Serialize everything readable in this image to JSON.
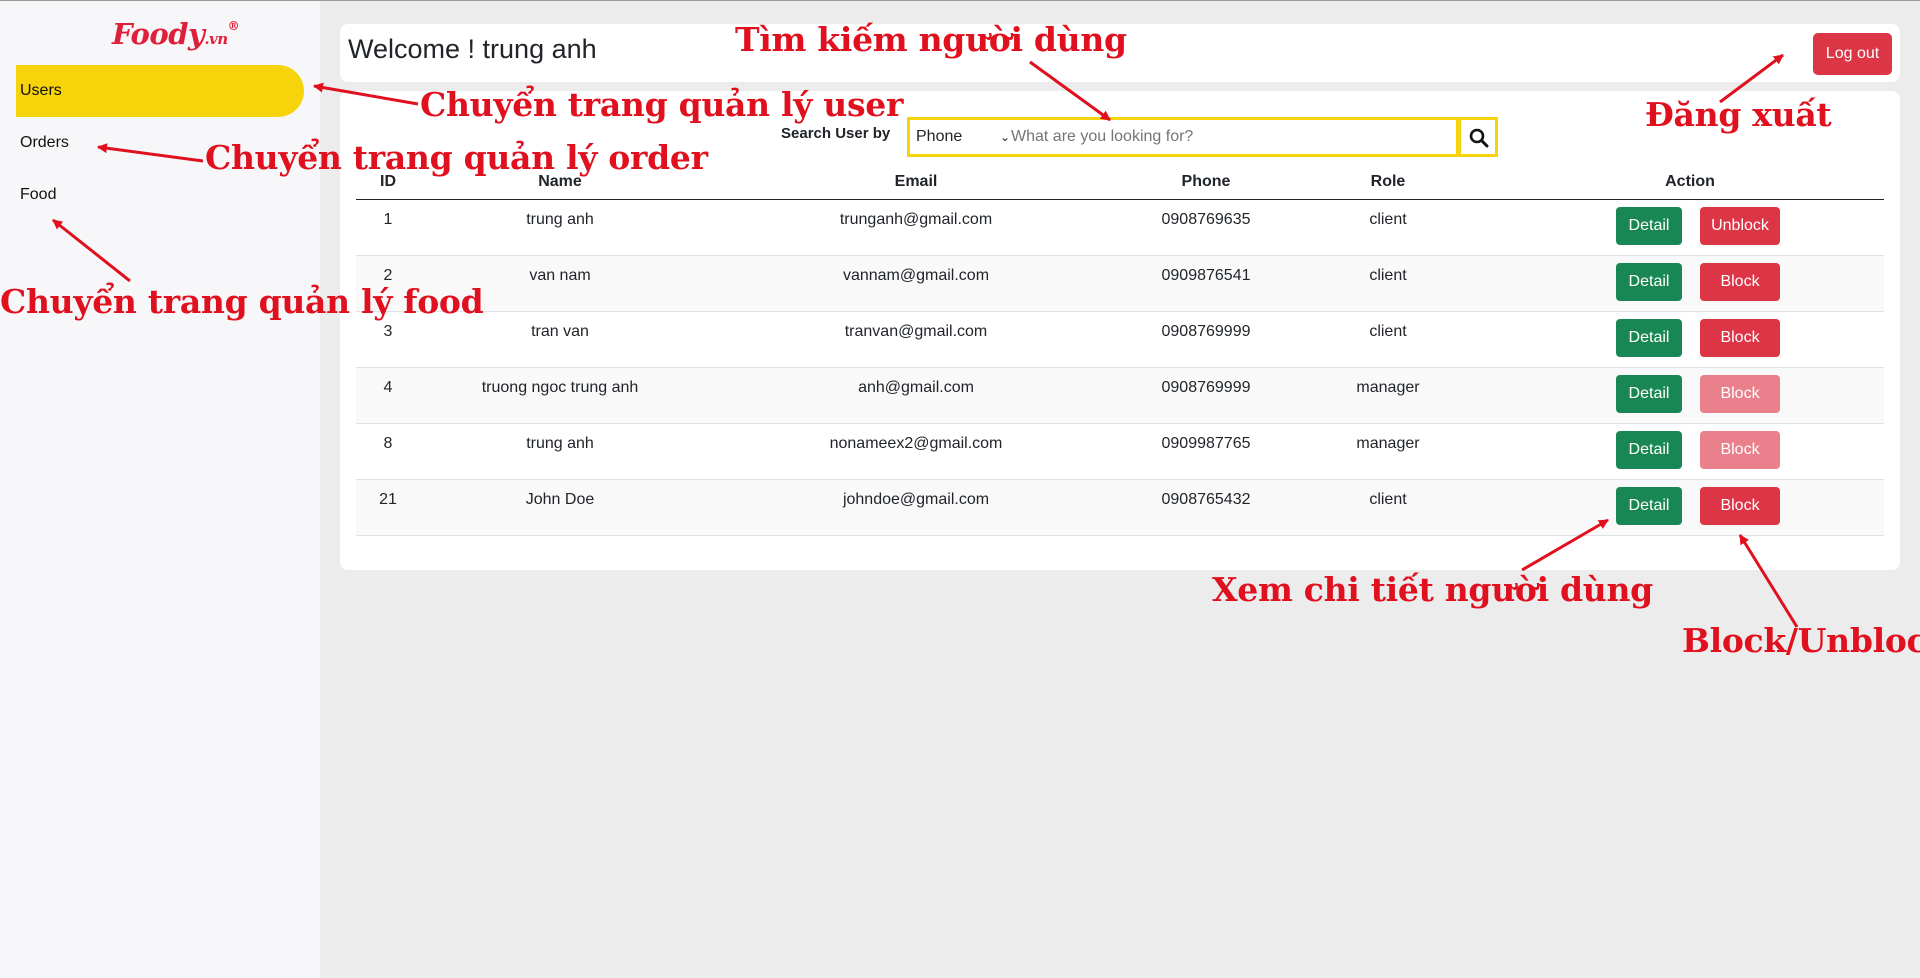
{
  "brand": {
    "logo_text": "Foody",
    "logo_suffix": ".vn",
    "logo_mark": "®"
  },
  "sidebar": {
    "items": [
      {
        "label": "Users",
        "active": true
      },
      {
        "label": "Orders",
        "active": false
      },
      {
        "label": "Food",
        "active": false
      }
    ]
  },
  "header": {
    "welcome": "Welcome ! trung anh",
    "logout_label": "Log out"
  },
  "search": {
    "label": "Search User by",
    "field": "Phone",
    "placeholder": "What are you looking for?",
    "button_icon": "search-icon"
  },
  "table": {
    "columns": [
      "ID",
      "Name",
      "Email",
      "Phone",
      "Role",
      "Action"
    ],
    "rows": [
      {
        "id": "1",
        "name": "trung anh",
        "email": "trunganh@gmail.com",
        "phone": "0908769635",
        "role": "client",
        "detail_label": "Detail",
        "block_label": "Unblock",
        "block_enabled": true
      },
      {
        "id": "2",
        "name": "van nam",
        "email": "vannam@gmail.com",
        "phone": "0909876541",
        "role": "client",
        "detail_label": "Detail",
        "block_label": "Block",
        "block_enabled": true
      },
      {
        "id": "3",
        "name": "tran van",
        "email": "tranvan@gmail.com",
        "phone": "0908769999",
        "role": "client",
        "detail_label": "Detail",
        "block_label": "Block",
        "block_enabled": true
      },
      {
        "id": "4",
        "name": "truong ngoc trung anh",
        "email": "anh@gmail.com",
        "phone": "0908769999",
        "role": "manager",
        "detail_label": "Detail",
        "block_label": "Block",
        "block_enabled": false
      },
      {
        "id": "8",
        "name": "trung anh",
        "email": "nonameex2@gmail.com",
        "phone": "0909987765",
        "role": "manager",
        "detail_label": "Detail",
        "block_label": "Block",
        "block_enabled": false
      },
      {
        "id": "21",
        "name": "John Doe",
        "email": "johndoe@gmail.com",
        "phone": "0908765432",
        "role": "client",
        "detail_label": "Detail",
        "block_label": "Block",
        "block_enabled": true
      }
    ]
  },
  "annotations": {
    "users": "Chuyển trang quản lý user",
    "orders": "Chuyển trang quản lý order",
    "food": "Chuyển trang quản lý food",
    "search": "Tìm kiếm người dùng",
    "logout": "Đăng xuất",
    "detail": "Xem chi tiết người dùng",
    "block": "Block/Unblock"
  },
  "colors": {
    "accent": "#f6d30a",
    "danger": "#dc3545",
    "danger_disabled": "#e9808b",
    "success": "#198754",
    "annotation": "#e0101e"
  }
}
